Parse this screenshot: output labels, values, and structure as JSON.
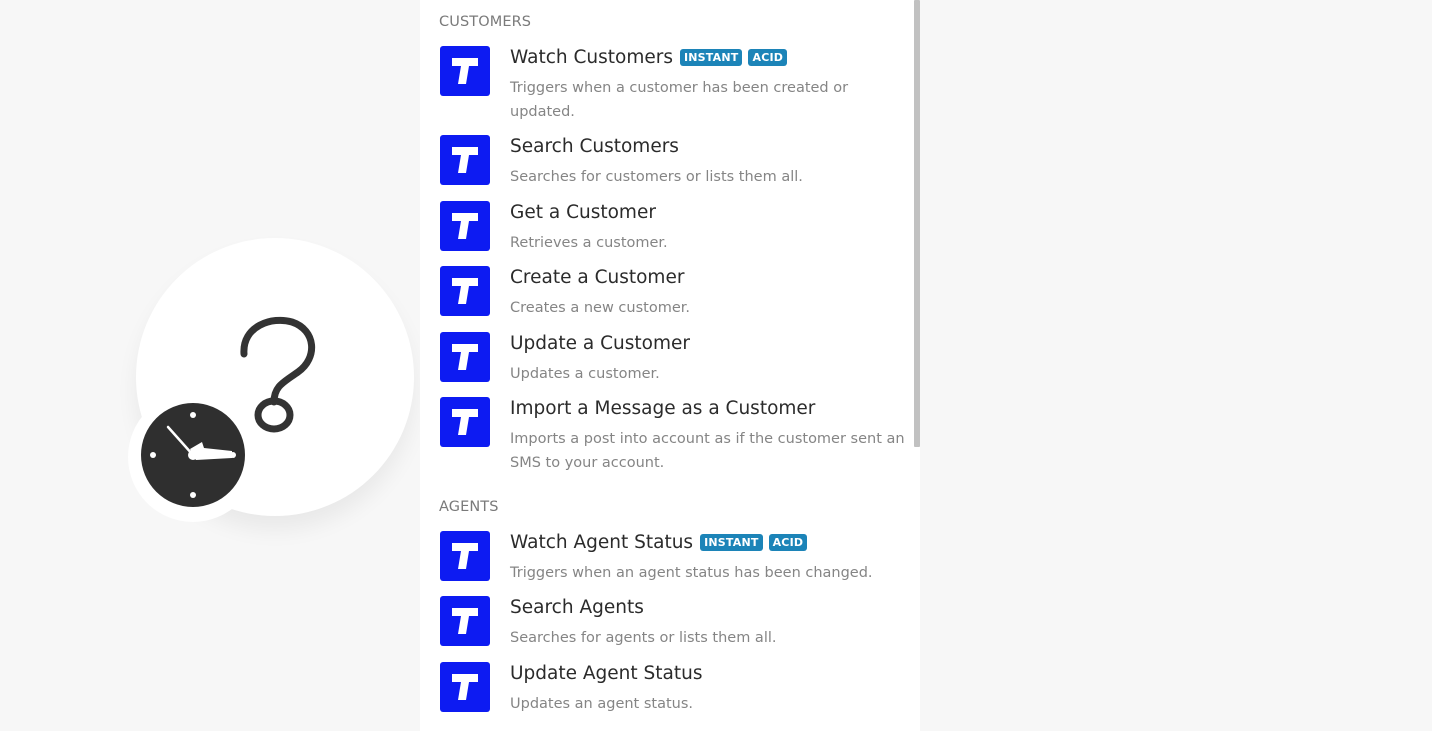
{
  "module": {
    "main_icon": "question-mark-icon",
    "badge_icon": "clock-icon"
  },
  "colors": {
    "app_icon_bg": "#0d1bf2",
    "badge_bg": "#1c84b8",
    "background": "#f7f7f7"
  },
  "sections": [
    {
      "title": "CUSTOMERS",
      "items": [
        {
          "title": "Watch Customers",
          "badges": [
            "INSTANT",
            "ACID"
          ],
          "description": "Triggers when a customer has been created or updated."
        },
        {
          "title": "Search Customers",
          "badges": [],
          "description": "Searches for customers or lists them all."
        },
        {
          "title": "Get a Customer",
          "badges": [],
          "description": "Retrieves a customer."
        },
        {
          "title": "Create a Customer",
          "badges": [],
          "description": "Creates a new customer."
        },
        {
          "title": "Update a Customer",
          "badges": [],
          "description": "Updates a customer."
        },
        {
          "title": "Import a Message as a Customer",
          "badges": [],
          "description": "Imports a post into account as if the customer sent an SMS to your account."
        }
      ]
    },
    {
      "title": "AGENTS",
      "items": [
        {
          "title": "Watch Agent Status",
          "badges": [
            "INSTANT",
            "ACID"
          ],
          "description": "Triggers when an agent status has been changed."
        },
        {
          "title": "Search Agents",
          "badges": [],
          "description": "Searches for agents or lists them all."
        },
        {
          "title": "Update Agent Status",
          "badges": [],
          "description": "Updates an agent status."
        }
      ]
    }
  ]
}
